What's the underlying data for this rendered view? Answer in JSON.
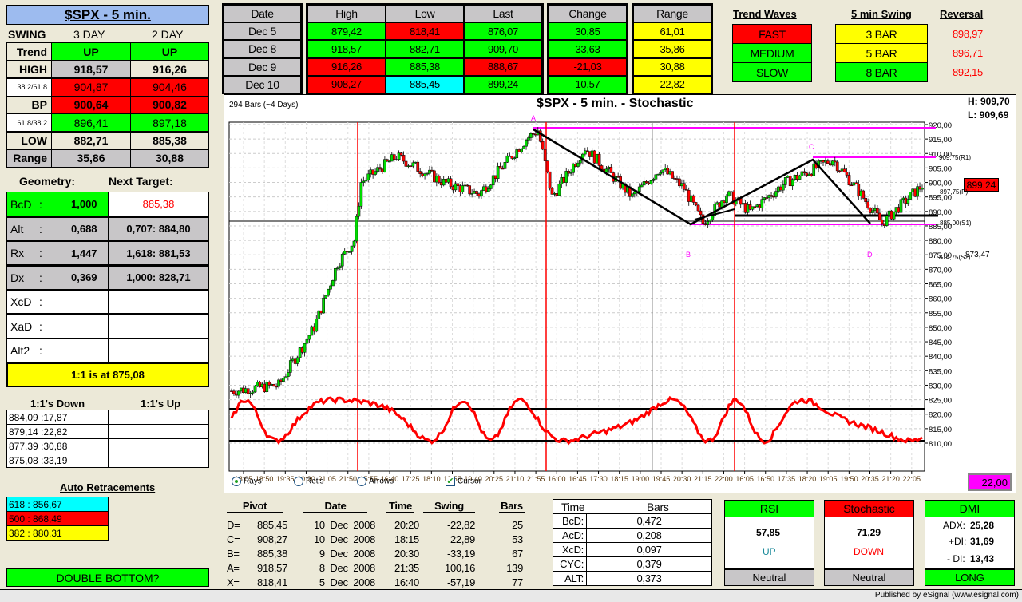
{
  "left": {
    "title": "$SPX - 5 min.",
    "swing_label": "SWING",
    "col1": "3 DAY",
    "col2": "2 DAY",
    "rows": [
      {
        "label": "Trend",
        "v1": "UP",
        "v2": "UP"
      },
      {
        "label": "HIGH",
        "v1": "918,57",
        "v2": "916,26"
      },
      {
        "label": "38.2/61.8",
        "v1": "904,87",
        "v2": "904,46"
      },
      {
        "label": "BP",
        "v1": "900,64",
        "v2": "900,82"
      },
      {
        "label": "61.8/38.2",
        "v1": "896,41",
        "v2": "897,18"
      },
      {
        "label": "LOW",
        "v1": "882,71",
        "v2": "885,38"
      },
      {
        "label": "Range",
        "v1": "35,86",
        "v2": "30,88"
      }
    ],
    "geometry_label": "Geometry:",
    "next_target_label": "Next Target:",
    "geometry": [
      {
        "label": "BcD",
        "value": "1,000",
        "target": "885,38"
      },
      {
        "label": "Alt",
        "value": "0,688",
        "target": "0,707: 884,80"
      },
      {
        "label": "Rx",
        "value": "1,447",
        "target": "1,618: 881,53"
      },
      {
        "label": "Dx",
        "value": "0,369",
        "target": "1,000: 828,71"
      },
      {
        "label": "XcD",
        "value": "",
        "target": ""
      },
      {
        "label": "XaD",
        "value": "",
        "target": ""
      },
      {
        "label": "Alt2",
        "value": "",
        "target": ""
      }
    ],
    "one_to_one": "1:1 is at 875,08",
    "ones_down_label": "1:1's Down",
    "ones_up_label": "1:1's Up",
    "ones_down": [
      "884,09 :17,87",
      "879,14 :22,82",
      "877,39 :30,88",
      "875,08 :33,19"
    ],
    "auto_retracements_label": "Auto Retracements",
    "retracements": [
      "618 : 856,67",
      "500 : 868,49",
      "382 : 880,31"
    ],
    "pattern_button": "DOUBLE BOTTOM?"
  },
  "top": {
    "headers": {
      "date": "Date",
      "high": "High",
      "low": "Low",
      "last": "Last",
      "change": "Change",
      "range": "Range"
    },
    "rows": [
      {
        "date": "Dec  5",
        "high": "879,42",
        "low": "818,41",
        "last": "876,07",
        "change": "30,85",
        "range": "61,01"
      },
      {
        "date": "Dec  8",
        "high": "918,57",
        "low": "882,71",
        "last": "909,70",
        "change": "33,63",
        "range": "35,86"
      },
      {
        "date": "Dec  9",
        "high": "916,26",
        "low": "885,38",
        "last": "888,67",
        "change": "-21,03",
        "range": "30,88"
      },
      {
        "date": "Dec  10",
        "high": "908,27",
        "low": "885,45",
        "last": "899,24",
        "change": "10,57",
        "range": "22,82"
      }
    ],
    "trend_waves_label": "Trend Waves",
    "trend_waves": [
      "FAST",
      "MEDIUM",
      "SLOW"
    ],
    "swing_label": "5 min Swing",
    "swings": [
      "3 BAR",
      "5 BAR",
      "8 BAR"
    ],
    "reversal_label": "Reversal",
    "reversals": [
      "898,97",
      "896,71",
      "892,15"
    ]
  },
  "chart": {
    "title": "$SPX - 5 min. - Stochastic",
    "bars_info": "294 Bars (~4 Days)",
    "high": "H:  909,70",
    "low": "L:  909,69",
    "last_price": "899,24",
    "value_box": "22,00",
    "side_labels": {
      "r1": "909,75(R1)",
      "p": "897,75(P)",
      "s1": "885,00(S1)",
      "s2": "874,75(S2)",
      "extra": "873,47"
    },
    "pivots": {
      "a": "A",
      "b": "B",
      "c": "C",
      "d": "D"
    },
    "options": {
      "rays": "Rays",
      "rets": "Ret's",
      "arrows": "Arrows",
      "cursor": "Cursor"
    }
  },
  "chart_data": {
    "type": "candlestick",
    "title": "$SPX - 5 min. - Stochastic",
    "ylim": [
      808,
      921
    ],
    "yticks": [
      "920,00",
      "915,00",
      "910,00",
      "905,00",
      "900,00",
      "895,00",
      "890,00",
      "885,00",
      "880,00",
      "875,00",
      "870,00",
      "865,00",
      "860,00",
      "855,00",
      "850,00",
      "845,00",
      "840,00",
      "835,00",
      "830,00",
      "825,00",
      "820,00",
      "815,00",
      "810,00"
    ],
    "xticks": [
      "18:05",
      "18:50",
      "19:35",
      "20:20",
      "21:05",
      "21:50",
      "15:55",
      "16:40",
      "17:25",
      "18:10",
      "18:55",
      "19:40",
      "20:25",
      "21:10",
      "21:55",
      "16:00",
      "16:45",
      "17:30",
      "18:15",
      "19:00",
      "19:45",
      "20:30",
      "21:15",
      "22:00",
      "16:05",
      "16:50",
      "17:35",
      "18:20",
      "19:05",
      "19:50",
      "20:35",
      "21:20",
      "22:05"
    ],
    "bars": 294,
    "price_keypoints": [
      [
        0,
        828
      ],
      [
        20,
        830
      ],
      [
        35,
        850
      ],
      [
        45,
        872
      ],
      [
        52,
        880
      ],
      [
        55,
        900
      ],
      [
        70,
        909
      ],
      [
        90,
        900
      ],
      [
        105,
        896
      ],
      [
        125,
        915
      ],
      [
        130,
        918
      ],
      [
        136,
        895
      ],
      [
        150,
        912
      ],
      [
        170,
        895
      ],
      [
        182,
        905
      ],
      [
        192,
        898
      ],
      [
        200,
        886
      ],
      [
        210,
        896
      ],
      [
        220,
        890
      ],
      [
        235,
        900
      ],
      [
        248,
        905
      ],
      [
        255,
        908
      ],
      [
        265,
        898
      ],
      [
        276,
        886
      ],
      [
        285,
        893
      ],
      [
        293,
        899
      ]
    ],
    "day_separators": [
      53,
      135,
      216
    ],
    "stochastic_levels": [
      80,
      20
    ],
    "horizontal_levels": [
      918.57,
      908.75,
      885.38,
      888.5,
      886.5
    ]
  },
  "pivot_table": {
    "headers": {
      "pivot": "Pivot",
      "date": "Date",
      "time": "Time",
      "swing": "Swing",
      "bars": "Bars"
    },
    "rows": [
      {
        "name": "D=",
        "price": "885,45",
        "date": "10  Dec  2008",
        "time": "20:20",
        "swing": "-22,82",
        "bars": "25"
      },
      {
        "name": "C=",
        "price": "908,27",
        "date": "10  Dec  2008",
        "time": "18:15",
        "swing": "22,89",
        "bars": "53"
      },
      {
        "name": "B=",
        "price": "885,38",
        "date": "9  Dec  2008",
        "time": "20:30",
        "swing": "-33,19",
        "bars": "67"
      },
      {
        "name": "A=",
        "price": "918,57",
        "date": "8  Dec  2008",
        "time": "21:35",
        "swing": "100,16",
        "bars": "139"
      },
      {
        "name": "X=",
        "price": "818,41",
        "date": "5  Dec  2008",
        "time": "16:40",
        "swing": "-57,19",
        "bars": "77"
      }
    ]
  },
  "ratio_table": {
    "time_label": "Time",
    "bars_label": "Bars",
    "rows": [
      {
        "k": "BcD:",
        "v": "0,472"
      },
      {
        "k": "AcD:",
        "v": "0,208"
      },
      {
        "k": "XcD:",
        "v": "0,097"
      },
      {
        "k": "CYC:",
        "v": "0,379"
      },
      {
        "k": "ALT:",
        "v": "0,373"
      }
    ]
  },
  "indicators": {
    "rsi": {
      "label": "RSI",
      "value": "57,85",
      "dir": "UP",
      "status": "Neutral"
    },
    "stoch": {
      "label": "Stochastic",
      "value": "71,29",
      "dir": "DOWN",
      "status": "Neutral"
    },
    "dmi": {
      "label": "DMI",
      "adx_label": "ADX:",
      "adx": "25,28",
      "pdi_label": "+DI:",
      "pdi": "31,69",
      "mdi_label": "- DI:",
      "mdi": "13,43",
      "status": "LONG"
    }
  },
  "status_bar": "Published by eSignal (www.esignal.com)"
}
